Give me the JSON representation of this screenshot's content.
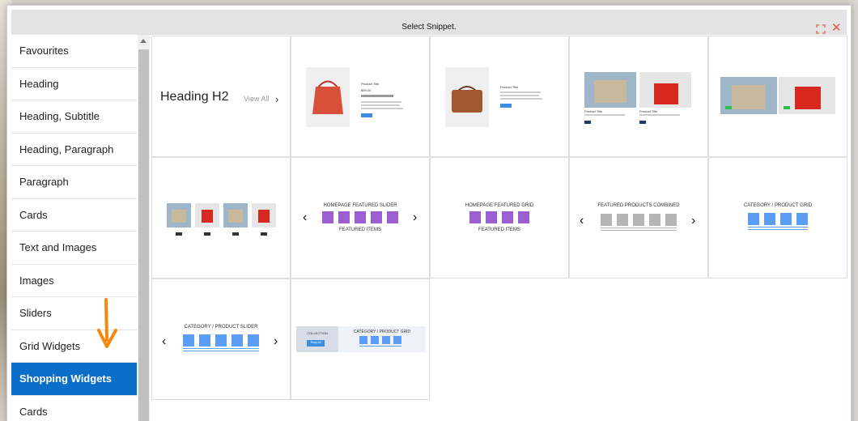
{
  "modal": {
    "title": "Select Snippet."
  },
  "sidebar": {
    "items": [
      {
        "label": "Favourites"
      },
      {
        "label": "Heading"
      },
      {
        "label": "Heading, Subtitle"
      },
      {
        "label": "Heading, Paragraph"
      },
      {
        "label": "Paragraph"
      },
      {
        "label": "Cards"
      },
      {
        "label": "Text and Images"
      },
      {
        "label": "Images"
      },
      {
        "label": "Sliders"
      },
      {
        "label": "Grid Widgets"
      },
      {
        "label": "Shopping Widgets"
      },
      {
        "label": "Cards"
      }
    ],
    "active_index": 10
  },
  "snippets": {
    "heading": {
      "title": "Heading H2",
      "link": "View All"
    },
    "featured_slider": {
      "title": "HOMEPAGE FEATURED SLIDER",
      "subtitle": "FEATURED ITEMS"
    },
    "featured_grid": {
      "title": "HOMEPAGE FEATURED GRID",
      "subtitle": "FEATURED ITEMS"
    },
    "combined": {
      "title": "FEATURED PRODUCTS COMBINED"
    },
    "cat_grid": {
      "title": "CATEGORY / PRODUCT GRID"
    },
    "cat_slider": {
      "title": "CATEGORY / PRODUCT SLIDER"
    },
    "collection": {
      "label": "COLLECTION",
      "button": "Shop All",
      "title": "CATEGORY / PRODUCT GRID"
    },
    "product1": {
      "title": "Product Title",
      "price": "$99.00"
    },
    "product2": {
      "title": "Product Title"
    },
    "product3": {
      "title_a": "Product Title",
      "title_b": "Product Title"
    }
  },
  "colors": {
    "accent": "#0b6fc9",
    "purple": "#9b5fd1",
    "blue": "#5b9cf5",
    "grey": "#b5b5b5",
    "close": "#e0594a",
    "arrow": "#f5890f"
  }
}
